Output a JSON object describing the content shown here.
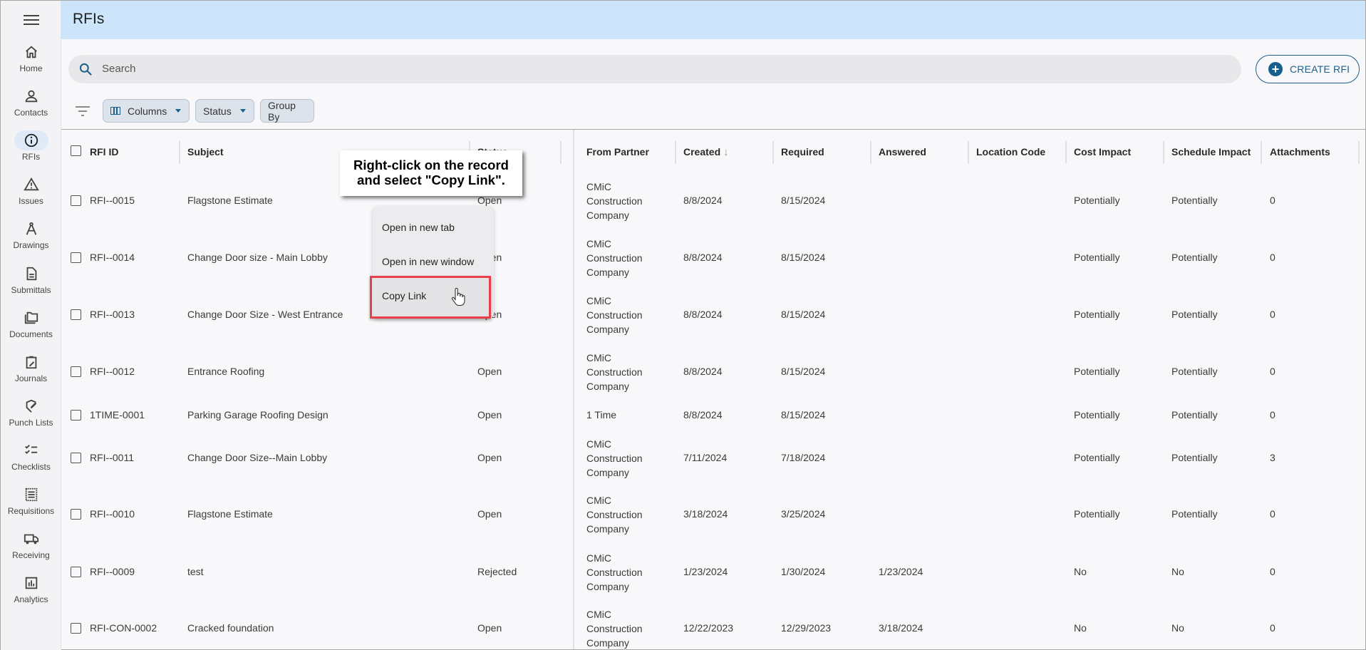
{
  "app": {
    "page_title": "RFIs"
  },
  "sidebar": {
    "menu_icon": "hamburger-menu-icon",
    "items": [
      {
        "label": "Home",
        "icon": "home-icon",
        "active": false
      },
      {
        "label": "Contacts",
        "icon": "person-icon",
        "active": false
      },
      {
        "label": "RFIs",
        "icon": "info-icon",
        "active": true
      },
      {
        "label": "Issues",
        "icon": "warning-icon",
        "active": false
      },
      {
        "label": "Drawings",
        "icon": "compass-icon",
        "active": false
      },
      {
        "label": "Submittals",
        "icon": "document-icon",
        "active": false
      },
      {
        "label": "Documents",
        "icon": "folder-icon",
        "active": false
      },
      {
        "label": "Journals",
        "icon": "clipboard-edit-icon",
        "active": false
      },
      {
        "label": "Punch Lists",
        "icon": "punch-list-icon",
        "active": false
      },
      {
        "label": "Checklists",
        "icon": "checklist-icon",
        "active": false
      },
      {
        "label": "Requisitions",
        "icon": "receipt-icon",
        "active": false
      },
      {
        "label": "Receiving",
        "icon": "truck-icon",
        "active": false
      },
      {
        "label": "Analytics",
        "icon": "bar-chart-icon",
        "active": false
      }
    ]
  },
  "search": {
    "placeholder": "Search",
    "value": ""
  },
  "toolbar": {
    "create_label": "CREATE RFI",
    "columns_label": "Columns",
    "status_label": "Status",
    "group_by_label": "Group By"
  },
  "colors": {
    "header_bg": "#cce5fb",
    "accent": "#1c5f8a",
    "highlight_border": "#e8404a"
  },
  "table": {
    "columns": [
      "RFI ID",
      "Subject",
      "Status",
      "From Partner",
      "Created",
      "Required",
      "Answered",
      "Location Code",
      "Cost Impact",
      "Schedule Impact",
      "Attachments"
    ],
    "sorted_column": "Created",
    "sort_direction": "descending",
    "rows": [
      {
        "id": "RFI--0015",
        "subject": "Flagstone Estimate",
        "status": "Open",
        "from_partner": "CMiC Construction Company",
        "created": "8/8/2024",
        "required": "8/15/2024",
        "answered": "",
        "location_code": "",
        "cost_impact": "Potentially",
        "schedule_impact": "Potentially",
        "attachments": "0"
      },
      {
        "id": "RFI--0014",
        "subject": "Change Door size - Main Lobby",
        "status": "Open",
        "from_partner": "CMiC Construction Company",
        "created": "8/8/2024",
        "required": "8/15/2024",
        "answered": "",
        "location_code": "",
        "cost_impact": "Potentially",
        "schedule_impact": "Potentially",
        "attachments": "0"
      },
      {
        "id": "RFI--0013",
        "subject": "Change Door Size - West Entrance",
        "status": "Open",
        "from_partner": "CMiC Construction Company",
        "created": "8/8/2024",
        "required": "8/15/2024",
        "answered": "",
        "location_code": "",
        "cost_impact": "Potentially",
        "schedule_impact": "Potentially",
        "attachments": "0"
      },
      {
        "id": "RFI--0012",
        "subject": "Entrance Roofing",
        "status": "Open",
        "from_partner": "CMiC Construction Company",
        "created": "8/8/2024",
        "required": "8/15/2024",
        "answered": "",
        "location_code": "",
        "cost_impact": "Potentially",
        "schedule_impact": "Potentially",
        "attachments": "0"
      },
      {
        "id": "1TIME-0001",
        "subject": "Parking Garage Roofing Design",
        "status": "Open",
        "from_partner": "1 Time",
        "created": "8/8/2024",
        "required": "8/15/2024",
        "answered": "",
        "location_code": "",
        "cost_impact": "Potentially",
        "schedule_impact": "Potentially",
        "attachments": "0"
      },
      {
        "id": "RFI--0011",
        "subject": "Change Door Size--Main Lobby",
        "status": "Open",
        "from_partner": "CMiC Construction Company",
        "created": "7/11/2024",
        "required": "7/18/2024",
        "answered": "",
        "location_code": "",
        "cost_impact": "Potentially",
        "schedule_impact": "Potentially",
        "attachments": "3"
      },
      {
        "id": "RFI--0010",
        "subject": "Flagstone Estimate",
        "status": "Open",
        "from_partner": "CMiC Construction Company",
        "created": "3/18/2024",
        "required": "3/25/2024",
        "answered": "",
        "location_code": "",
        "cost_impact": "Potentially",
        "schedule_impact": "Potentially",
        "attachments": "0"
      },
      {
        "id": "RFI--0009",
        "subject": "test",
        "status": "Rejected",
        "from_partner": "CMiC Construction Company",
        "created": "1/23/2024",
        "required": "1/30/2024",
        "answered": "1/23/2024",
        "location_code": "",
        "cost_impact": "No",
        "schedule_impact": "No",
        "attachments": "0"
      },
      {
        "id": "RFI-CON-0002",
        "subject": "Cracked foundation",
        "status": "Open",
        "from_partner": "CMiC Construction Company",
        "created": "12/22/2023",
        "required": "12/29/2023",
        "answered": "3/18/2024",
        "location_code": "",
        "cost_impact": "No",
        "schedule_impact": "No",
        "attachments": "0"
      }
    ]
  },
  "context_menu": {
    "items": [
      "Open in new tab",
      "Open in new window",
      "Copy Link"
    ],
    "highlighted": "Copy Link"
  },
  "annotation": {
    "callout_line1": "Right-click on the record",
    "callout_line2": "and select \"Copy Link\"."
  }
}
